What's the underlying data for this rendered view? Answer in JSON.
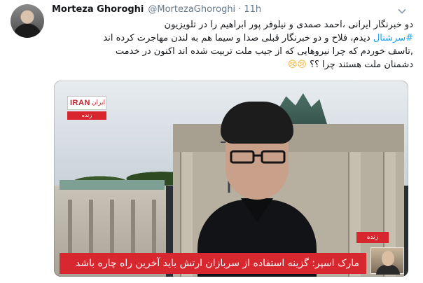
{
  "tweet": {
    "author_name": "Morteza Ghoroghi",
    "handle": "@MortezaGhoroghi",
    "separator": "·",
    "time": "11h",
    "text": {
      "line1": "دو خبرنگار ایرانی ،احمد صمدی و نیلوفر پور ابراهیم را در تلویزیون",
      "line2_hashtag": "#سرشنال",
      "line2_rest": " دیدم، فلاح و دو خبرنگار قبلی صدا و سیما هم به لندن مهاجرت کرده اند",
      "line3": ",تاسف خوردم که چرا نیروهایی که از جیب ملت تربیت شده اند اکنون در خدمت",
      "line4_text": "دشمنان ملت هستند چرا ؟؟",
      "line4_emoji": "😢😢"
    },
    "icons": {
      "menu": "chevron-down-icon"
    }
  },
  "media": {
    "channel_logo_latin": "IRAN",
    "channel_logo_fa": "ایران",
    "live_label_top": "زنده",
    "live_label_bottom": "زنده",
    "caption": "مارک اسپر: گزینه استفاده از سربازان ارتش باید آخرین راه چاره باشد"
  },
  "colors": {
    "hashtag": "#1da1f2",
    "muted": "#657786",
    "live_red": "#d7262d"
  }
}
